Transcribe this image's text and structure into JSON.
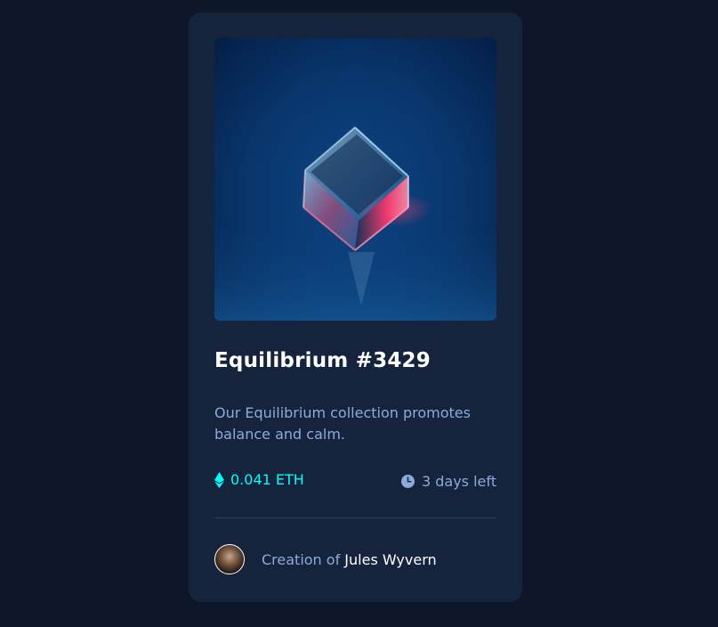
{
  "card": {
    "title": "Equilibrium #3429",
    "description": "Our Equilibrium collection promotes balance and calm.",
    "price": "0.041 ETH",
    "time_left": "3 days left",
    "creator_prefix": "Creation of",
    "creator_name": "Jules Wyvern",
    "icons": {
      "price": "ethereum-icon",
      "time": "clock-icon",
      "image": "equilibrium-cube-image"
    }
  },
  "colors": {
    "page_bg": "#0d1729",
    "card_bg": "#15233d",
    "accent_cyan": "#00fff8",
    "soft_blue": "#8bacda",
    "white": "#ffffff",
    "divider": "#2e405a"
  }
}
